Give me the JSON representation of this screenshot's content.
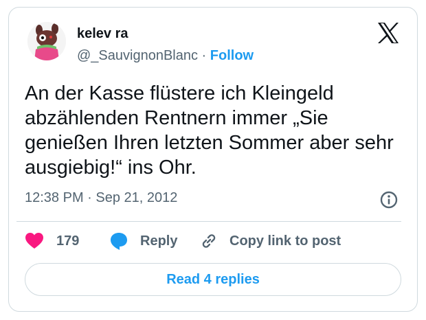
{
  "author": {
    "name": "kelev ra",
    "handle": "@_SauvignonBlanc",
    "separator": "·",
    "follow_label": "Follow"
  },
  "tweet": {
    "text": "An der Kasse flüstere ich Kleingeld abzählenden Rentnern immer „Sie genießen Ihren letzten Sommer aber sehr ausgiebig!“ ins Ohr.",
    "timestamp": "12:38 PM · Sep 21, 2012"
  },
  "actions": {
    "like_count": "179",
    "reply_label": "Reply",
    "copy_label": "Copy link to post"
  },
  "read_replies_label": "Read 4 replies",
  "colors": {
    "accent": "#1d9bf0",
    "like": "#f91880",
    "muted": "#536471",
    "text": "#0f1419",
    "border": "#cfd9de"
  },
  "icons": [
    "x-logo-icon",
    "info-icon",
    "heart-icon",
    "reply-bubble-icon",
    "link-icon"
  ]
}
